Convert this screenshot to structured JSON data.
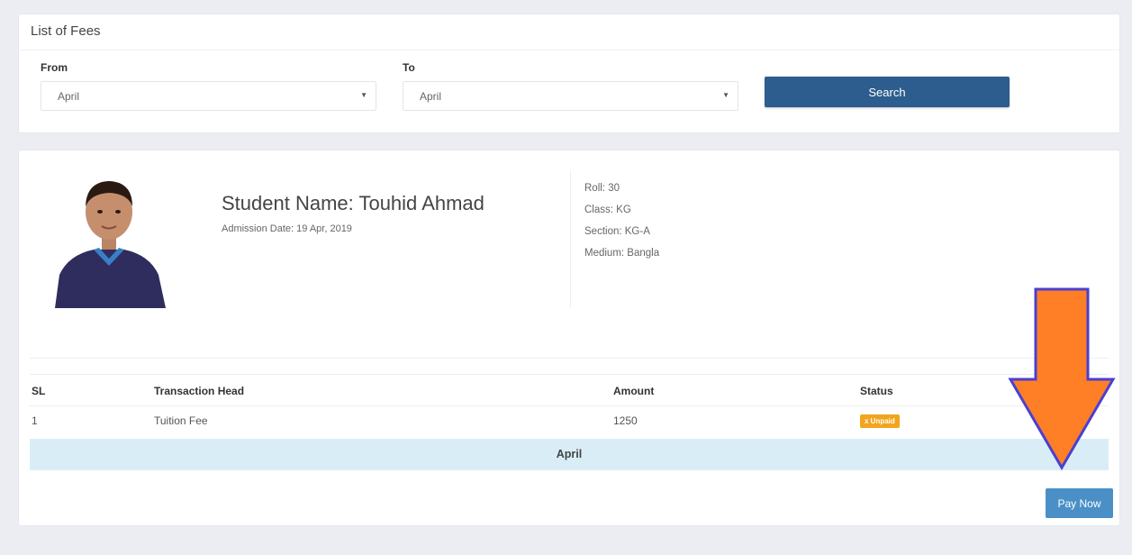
{
  "filter": {
    "title": "List of Fees",
    "from_label": "From",
    "from_value": "April",
    "to_label": "To",
    "to_value": "April",
    "search_label": "Search"
  },
  "student": {
    "name": "Student Name: Touhid Ahmad",
    "admission_date": "Admission Date: 19 Apr, 2019",
    "roll": "Roll: 30",
    "class": "Class: KG",
    "section": "Section: KG-A",
    "medium": "Medium: Bangla"
  },
  "table": {
    "headers": [
      "SL",
      "Transaction Head",
      "Amount",
      "Status"
    ],
    "rows": [
      {
        "sl": "1",
        "head": "Tuition Fee",
        "amount": "1250",
        "status": "x Unpaid"
      }
    ],
    "month": "April"
  },
  "actions": {
    "pay_now_label": "Pay Now"
  },
  "colors": {
    "primary": "#2c5d8e",
    "pay_button": "#4a90c6",
    "unpaid_badge": "#f2a51c",
    "month_bar": "#d9edf7",
    "arrow_fill": "#ff7f27",
    "arrow_stroke": "#4a3fd1"
  }
}
